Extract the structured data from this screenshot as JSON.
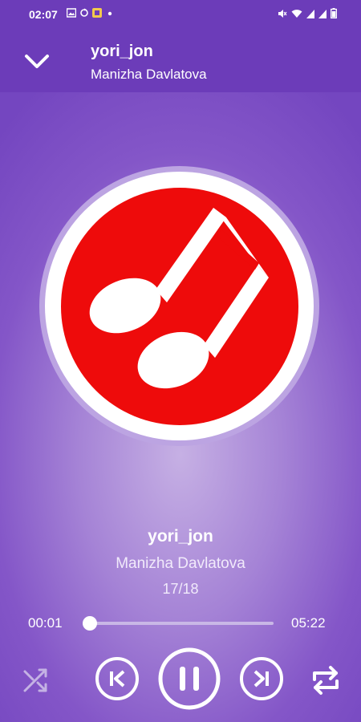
{
  "status_bar": {
    "time": "02:07"
  },
  "header": {
    "title": "yori_jon",
    "artist": "Manizha Davlatova"
  },
  "now_playing": {
    "title": "yori_jon",
    "artist": "Manizha Davlatova",
    "track_position": "17/18",
    "elapsed": "00:01",
    "duration": "05:22",
    "progress_fraction": 0.003
  },
  "controls": {
    "shuffle": "shuffle-icon",
    "previous": "skip-previous-icon",
    "play_pause": "pause-icon",
    "next": "skip-next-icon",
    "repeat": "repeat-icon"
  },
  "colors": {
    "header": "#6c3cb9",
    "album_red": "#ee0b0b",
    "accent_white": "#ffffff"
  }
}
